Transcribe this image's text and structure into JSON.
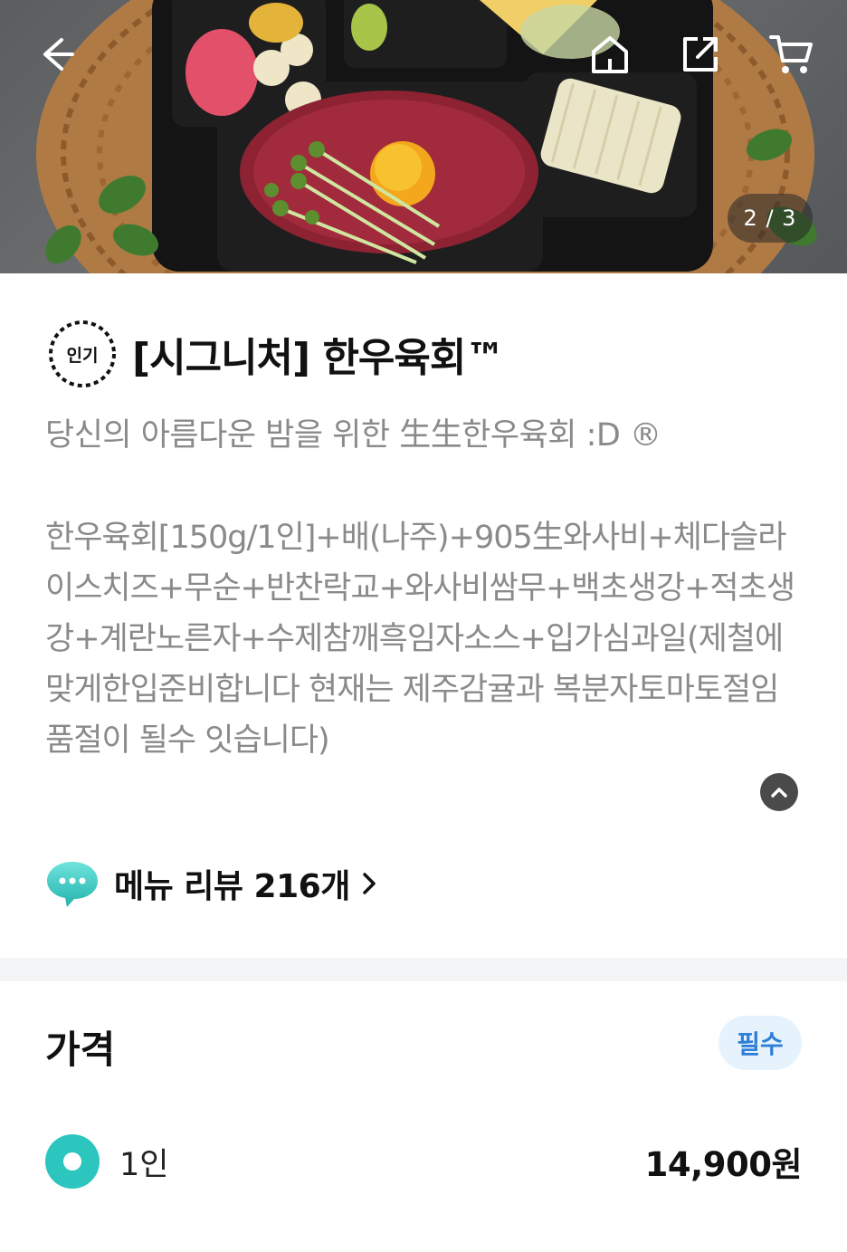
{
  "hero": {
    "counter": "2 / 3",
    "icons": [
      "back-arrow-icon",
      "home-icon",
      "share-icon",
      "cart-icon"
    ]
  },
  "product": {
    "badge": "인기",
    "title": "[시그니처] 한우육회™",
    "subtitle": "당신의 아름다운 밤을 위한 生生한우육회 :D ®",
    "description": "한우육회[150g/1인]+배(나주)+905生와사비+체다슬라이스치즈+무순+반찬락교+와사비쌈무+백초생강+적초생강+계란노른자+수제참깨흑임자소스+입가심과일(제철에맞게한입준비합니다 현재는 제주감귤과 복분자토마토절임 품절이 될수 잇습니다)"
  },
  "review": {
    "label": "메뉴 리뷰 216개"
  },
  "price": {
    "section_title": "가격",
    "required_badge": "필수",
    "options": [
      {
        "label": "1인",
        "price": "14,900원",
        "selected": true
      }
    ]
  },
  "colors": {
    "accent": "#2cc6bf",
    "required_bg": "#e6f3fd",
    "required_text": "#2f7fd8",
    "muted_text": "#8a8a8a"
  }
}
